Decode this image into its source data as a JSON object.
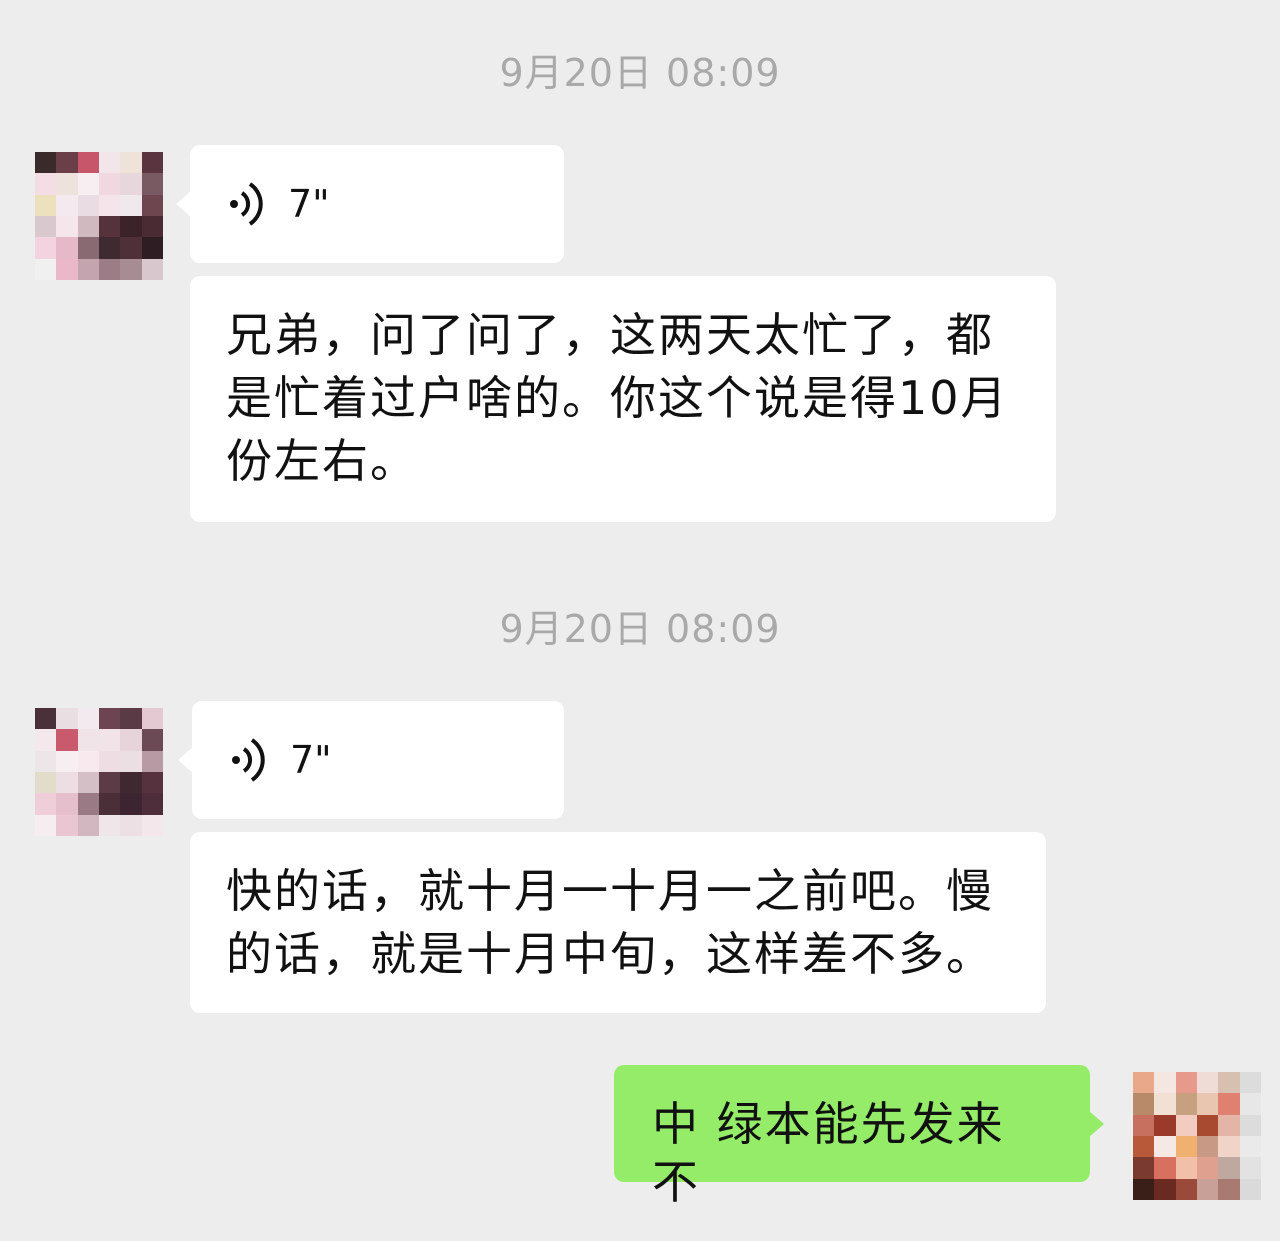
{
  "messages": [
    {
      "type": "timestamp",
      "text": "9月20日 08:09"
    },
    {
      "type": "voice",
      "direction": "in",
      "duration": "7\""
    },
    {
      "type": "text",
      "direction": "in",
      "text": "兄弟，问了问了，这两天太忙了，都是忙着过户啥的。你这个说是得10月份左右。"
    },
    {
      "type": "timestamp",
      "text": "9月20日 08:09"
    },
    {
      "type": "voice",
      "direction": "in",
      "duration": "7\""
    },
    {
      "type": "text",
      "direction": "in",
      "text": "快的话，就十月一十月一之前吧。慢的话，就是十月中旬，这样差不多。"
    },
    {
      "type": "text",
      "direction": "out",
      "text": "中 绿本能先发来不"
    }
  ],
  "colors": {
    "background": "#ededed",
    "incoming_bubble": "#ffffff",
    "outgoing_bubble": "#95ec69",
    "timestamp_text": "#a9a9a9"
  },
  "icons": {
    "voice": "voice-wave-icon",
    "avatar": "pixelated-avatar"
  }
}
